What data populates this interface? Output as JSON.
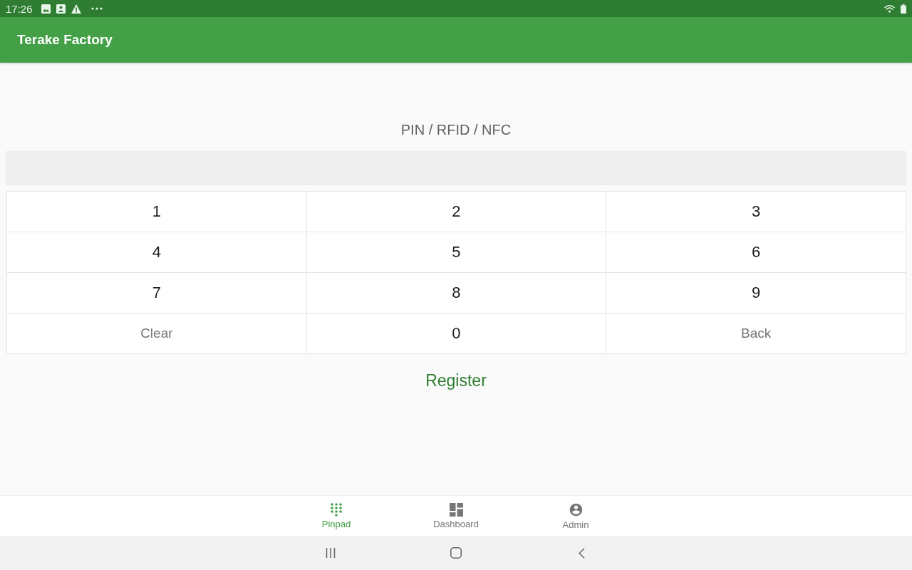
{
  "status_bar": {
    "time": "17:26"
  },
  "app_bar": {
    "title": "Terake Factory"
  },
  "pin_entry": {
    "label": "PIN / RFID / NFC"
  },
  "keypad": {
    "keys": [
      {
        "label": "1",
        "kind": "digit"
      },
      {
        "label": "2",
        "kind": "digit"
      },
      {
        "label": "3",
        "kind": "digit"
      },
      {
        "label": "4",
        "kind": "digit"
      },
      {
        "label": "5",
        "kind": "digit"
      },
      {
        "label": "6",
        "kind": "digit"
      },
      {
        "label": "7",
        "kind": "digit"
      },
      {
        "label": "8",
        "kind": "digit"
      },
      {
        "label": "9",
        "kind": "digit"
      },
      {
        "label": "Clear",
        "kind": "action"
      },
      {
        "label": "0",
        "kind": "digit"
      },
      {
        "label": "Back",
        "kind": "action"
      }
    ]
  },
  "register_button": {
    "label": "Register"
  },
  "bottom_nav": {
    "items": [
      {
        "label": "Pinpad",
        "kind": "pinpad",
        "selected": true
      },
      {
        "label": "Dashboard",
        "kind": "dashboard",
        "selected": false
      },
      {
        "label": "Admin",
        "kind": "admin",
        "selected": false
      }
    ]
  }
}
